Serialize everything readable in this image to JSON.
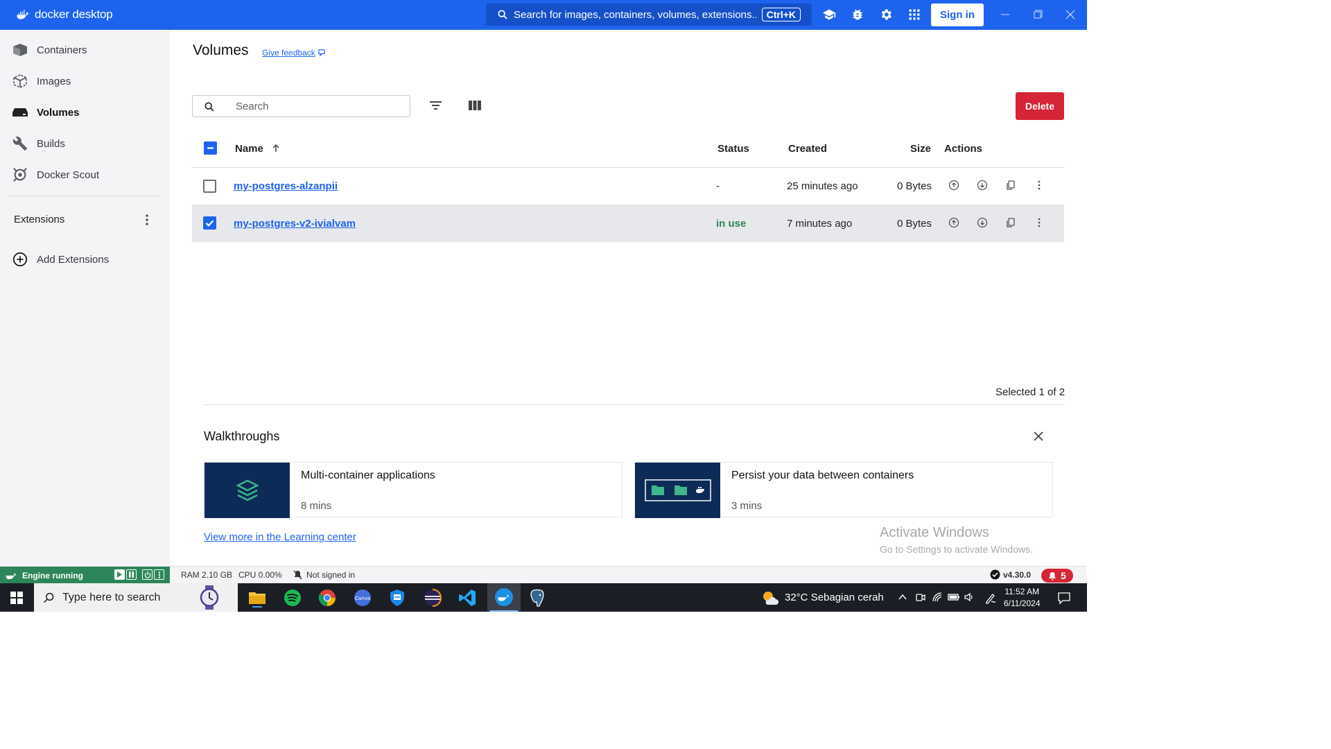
{
  "app": {
    "logo_text": "docker desktop",
    "search_placeholder": "Search for images, containers, volumes, extensions...",
    "search_shortcut": "Ctrl+K",
    "signin_label": "Sign in"
  },
  "sidebar": {
    "items": [
      {
        "label": "Containers",
        "icon": "containers-icon"
      },
      {
        "label": "Images",
        "icon": "images-icon"
      },
      {
        "label": "Volumes",
        "icon": "volumes-icon",
        "active": true
      },
      {
        "label": "Builds",
        "icon": "builds-icon"
      },
      {
        "label": "Docker Scout",
        "icon": "docker-scout-icon"
      }
    ],
    "extensions_label": "Extensions",
    "add_extensions_label": "Add Extensions"
  },
  "main": {
    "title": "Volumes",
    "feedback_label": "Give feedback",
    "search_placeholder": "Search",
    "delete_label": "Delete",
    "columns": {
      "name": "Name",
      "status": "Status",
      "created": "Created",
      "size": "Size",
      "actions": "Actions"
    },
    "rows": [
      {
        "name": "my-postgres-alzanpii",
        "status": "-",
        "created": "25 minutes ago",
        "size": "0 Bytes",
        "selected": false
      },
      {
        "name": "my-postgres-v2-ivialvam",
        "status": "in use",
        "created": "7 minutes ago",
        "size": "0 Bytes",
        "selected": true
      }
    ],
    "selected_count": "Selected 1 of 2"
  },
  "walkthroughs": {
    "title": "Walkthroughs",
    "cards": [
      {
        "title": "Multi-container applications",
        "duration": "8 mins"
      },
      {
        "title": "Persist your data between containers",
        "duration": "3 mins"
      }
    ],
    "learn_more": "View more in the Learning center"
  },
  "watermark": {
    "line1": "Activate Windows",
    "line2": "Go to Settings to activate Windows."
  },
  "statusbar": {
    "engine": "Engine running",
    "ram": "RAM 2.10 GB",
    "cpu": "CPU 0.00%",
    "signin_status": "Not signed in",
    "version": "v4.30.0",
    "notifications": "5"
  },
  "taskbar": {
    "search_placeholder": "Type here to search",
    "weather": "32°C  Sebagian cerah",
    "time": "11:52 AM",
    "date": "6/11/2024"
  },
  "colors": {
    "brand_blue": "#1d63ed",
    "danger": "#d52536",
    "engine_green": "#2d8659"
  }
}
